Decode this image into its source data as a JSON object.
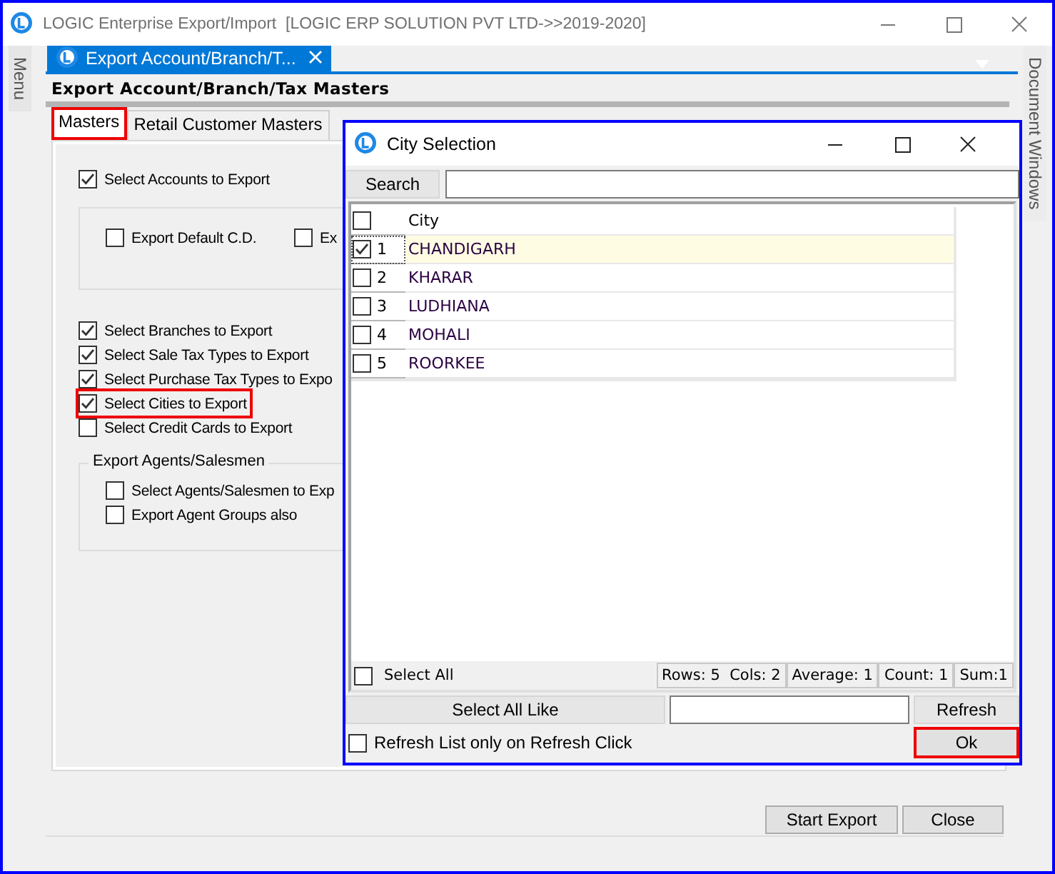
{
  "window": {
    "title": "LOGIC Enterprise Export/Import  [LOGIC ERP SOLUTION PVT LTD->>2019-2020]"
  },
  "side_panels": {
    "left": "Menu",
    "right": "Document Windows"
  },
  "document_tab": {
    "label": "Export Account/Branch/T..."
  },
  "heading": "Export Account/Branch/Tax Masters",
  "tabs": [
    {
      "label": "Masters",
      "selected": true,
      "highlighted": true
    },
    {
      "label": "Retail Customer Masters",
      "selected": false,
      "highlighted": false
    }
  ],
  "options_top": [
    {
      "label": "Select Accounts to Export",
      "checked": true
    }
  ],
  "accounts_group": [
    {
      "label": "Export Default C.D.",
      "checked": false
    },
    {
      "label": "Ex",
      "checked": false
    }
  ],
  "options": [
    {
      "label": "Select Branches to Export",
      "checked": true,
      "highlighted": false
    },
    {
      "label": "Select Sale Tax Types to Export",
      "checked": true,
      "highlighted": false
    },
    {
      "label": "Select Purchase Tax Types to Expo",
      "checked": true,
      "highlighted": false
    },
    {
      "label": "Select Cities to Export",
      "checked": true,
      "highlighted": true
    },
    {
      "label": "Select Credit Cards to Export",
      "checked": false,
      "highlighted": false
    }
  ],
  "agents_group": {
    "title": "Export Agents/Salesmen",
    "options": [
      {
        "label": "Select Agents/Salesmen to Exp",
        "checked": false
      },
      {
        "label": "Export Agent Groups also",
        "checked": false
      }
    ]
  },
  "buttons": [
    {
      "label": "Start Export"
    },
    {
      "label": "Close"
    }
  ],
  "dialog": {
    "title": "City Selection",
    "search_button": "Search",
    "header": {
      "checked": false,
      "column": "City"
    },
    "rows": [
      {
        "number": "1",
        "city": "CHANDIGARH",
        "checked": true,
        "selected": true
      },
      {
        "number": "2",
        "city": "KHARAR",
        "checked": false,
        "selected": false
      },
      {
        "number": "3",
        "city": "LUDHIANA",
        "checked": false,
        "selected": false
      },
      {
        "number": "4",
        "city": "MOHALI",
        "checked": false,
        "selected": false
      },
      {
        "number": "5",
        "city": "ROORKEE",
        "checked": false,
        "selected": false
      }
    ],
    "select_all": {
      "label": "Select All",
      "checked": false
    },
    "stats": [
      "Rows: 5  Cols: 2",
      "Average: 1",
      "Count: 1",
      "Sum:1"
    ],
    "select_all_like": "Select All Like",
    "refresh": "Refresh",
    "refresh_only": {
      "label": "Refresh List only on Refresh Click",
      "checked": false
    },
    "ok": {
      "label": "Ok",
      "highlighted": true
    }
  }
}
